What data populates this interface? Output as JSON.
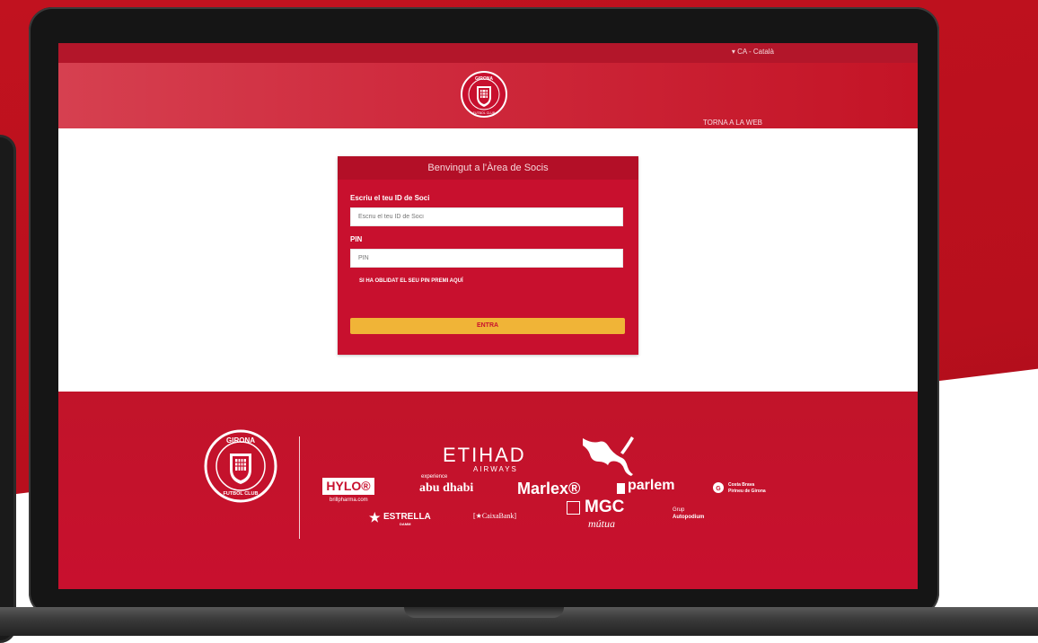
{
  "header": {
    "language": "▾ CA - Català",
    "back_link": "TORNA A LA WEB",
    "logo_text_top": "GIRONA",
    "logo_text_bottom": "FUTBOL CLUB"
  },
  "login": {
    "title": "Benvingut a l'Àrea de Socis",
    "id_label": "Escriu el teu ID de Soci",
    "id_placeholder": "Escriu el teu ID de Soci",
    "pin_label": "PIN",
    "pin_placeholder": "PIN",
    "forgot_link": "SI HA OBLIDAT EL SEU PIN PREMI AQUÍ",
    "submit": "ENTRA"
  },
  "footer": {
    "crest_text_top": "GIRONA",
    "crest_text_bottom": "FUTBOL CLUB",
    "sponsors": {
      "etihad": "ETIHAD",
      "etihad_sub": "AIRWAYS",
      "hylo": "HYLO®",
      "hylo_sub": "brillpharma.com",
      "abu_top": "experience",
      "abu": "abu dhabi",
      "marlex": "Marlex®",
      "parlem": "parlem",
      "costa": "Costa Brava",
      "costa_sub": "Pirineu de Girona",
      "estrella": "ESTRELLA",
      "estrella_sub": "DAMM",
      "caixabank": "CaixaBank",
      "mgc": "MGC",
      "mgc_sub": "mútua",
      "grup": "Grup",
      "autopodium": "Autopodium"
    }
  },
  "colors": {
    "brand_red": "#c8102e",
    "button_yellow": "#f0b437"
  }
}
